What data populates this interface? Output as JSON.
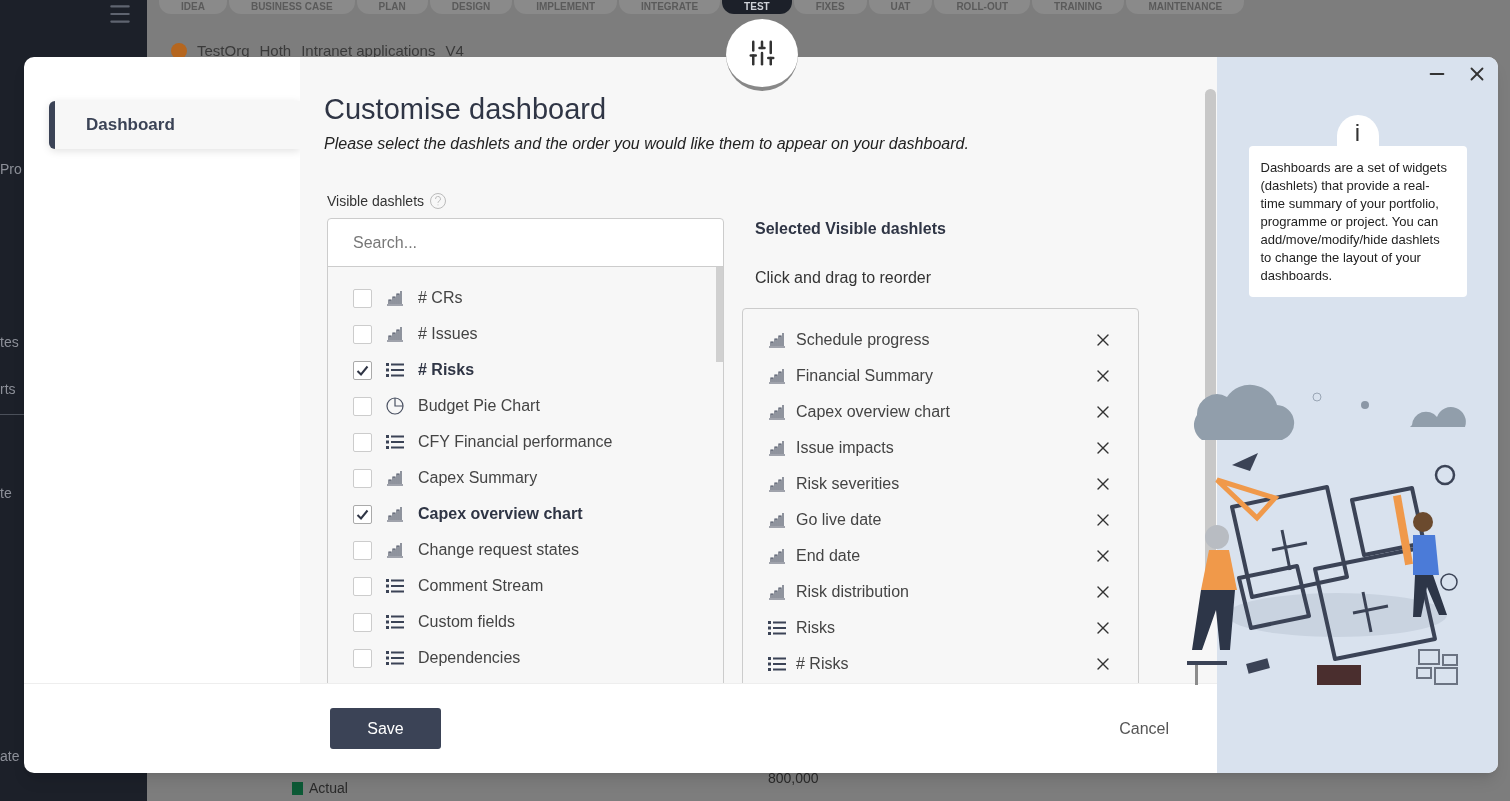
{
  "background": {
    "stages": [
      {
        "label": "IDEA",
        "selected": false
      },
      {
        "label": "BUSINESS CASE",
        "selected": false
      },
      {
        "label": "PLAN",
        "selected": false
      },
      {
        "label": "DESIGN",
        "selected": false
      },
      {
        "label": "IMPLEMENT",
        "selected": false
      },
      {
        "label": "INTEGRATE",
        "selected": false
      },
      {
        "label": "TEST",
        "selected": true
      },
      {
        "label": "FIXES",
        "selected": false
      },
      {
        "label": "UAT",
        "selected": false
      },
      {
        "label": "ROLL-OUT",
        "selected": false
      },
      {
        "label": "TRAINING",
        "selected": false
      },
      {
        "label": "MAINTENANCE",
        "selected": false
      }
    ],
    "breadcrumb": [
      "TestOrg",
      "Hoth",
      "Intranet applications",
      "V4"
    ],
    "sidebar_fragments": [
      "Pro",
      "tes",
      "rts",
      "te",
      "ate"
    ],
    "legend": "Actual",
    "axis_tick": "800,000"
  },
  "dialog": {
    "nav": [
      {
        "label": "Dashboard",
        "selected": true
      }
    ],
    "title": "Customise dashboard",
    "subtitle": "Please select the dashlets and the order you would like them to appear on your dashboard.",
    "visible_label": "Visible dashlets",
    "search": {
      "placeholder": "Search..."
    },
    "available": [
      {
        "label": "# CRs",
        "kind": "bar",
        "checked": false
      },
      {
        "label": "# Issues",
        "kind": "bar",
        "checked": false
      },
      {
        "label": "# Risks",
        "kind": "list",
        "checked": true
      },
      {
        "label": "Budget Pie Chart",
        "kind": "pie",
        "checked": false
      },
      {
        "label": "CFY Financial performance",
        "kind": "list",
        "checked": false
      },
      {
        "label": "Capex Summary",
        "kind": "bar",
        "checked": false
      },
      {
        "label": "Capex overview chart",
        "kind": "bar",
        "checked": true
      },
      {
        "label": "Change request states",
        "kind": "bar",
        "checked": false
      },
      {
        "label": "Comment Stream",
        "kind": "list",
        "checked": false
      },
      {
        "label": "Custom fields",
        "kind": "list",
        "checked": false
      },
      {
        "label": "Dependencies",
        "kind": "list",
        "checked": false
      }
    ],
    "selected_heading": "Selected Visible dashlets",
    "selected_hint": "Click and drag to reorder",
    "selected": [
      {
        "label": "Schedule progress",
        "kind": "bar"
      },
      {
        "label": "Financial Summary",
        "kind": "bar"
      },
      {
        "label": "Capex overview chart",
        "kind": "bar"
      },
      {
        "label": "Issue impacts",
        "kind": "bar"
      },
      {
        "label": "Risk severities",
        "kind": "bar"
      },
      {
        "label": "Go live date",
        "kind": "bar"
      },
      {
        "label": "End date",
        "kind": "bar"
      },
      {
        "label": "Risk distribution",
        "kind": "bar"
      },
      {
        "label": "Risks",
        "kind": "list"
      },
      {
        "label": "# Risks",
        "kind": "list"
      }
    ],
    "save": "Save",
    "cancel": "Cancel",
    "info": {
      "icon_text": "i",
      "text": "Dashboards are a set of widgets (dashlets) that provide a real-time summary of your portfolio, programme or project. You can add/move/modify/hide dashlets to change the layout of your dashboards."
    }
  }
}
